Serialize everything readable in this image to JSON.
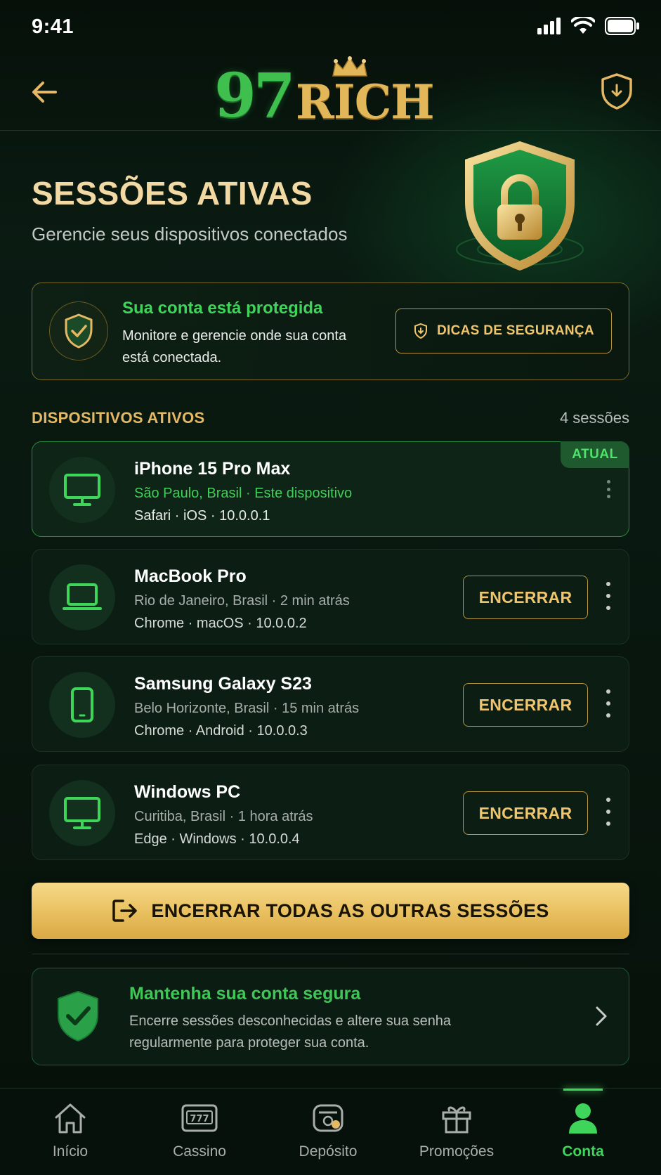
{
  "status_bar": {
    "time": "9:41"
  },
  "header": {
    "logo_number": "97",
    "logo_word": "RICH"
  },
  "hero": {
    "title": "SESSÕES ATIVAS",
    "subtitle": "Gerencie seus dispositivos conectados"
  },
  "protection": {
    "title": "Sua conta está protegida",
    "description": "Monitore e gerencie onde sua conta está conectada.",
    "tips_button": "DICAS DE SEGURANÇA"
  },
  "devices_section": {
    "title": "DISPOSITIVOS ATIVOS",
    "count": "4 sessões"
  },
  "devices": [
    {
      "name": "iPhone 15 Pro Max",
      "location": "São Paulo, Brasil · Este dispositivo",
      "meta": "Safari · iOS · 10.0.0.1",
      "badge": "ATUAL",
      "icon": "monitor-icon"
    },
    {
      "name": "MacBook Pro",
      "location": "Rio de Janeiro, Brasil · 2 min atrás",
      "meta": "Chrome · macOS · 10.0.0.2",
      "action": "ENCERRAR",
      "icon": "laptop-icon"
    },
    {
      "name": "Samsung Galaxy S23",
      "location": "Belo Horizonte, Brasil · 15 min atrás",
      "meta": "Chrome · Android · 10.0.0.3",
      "action": "ENCERRAR",
      "icon": "phone-icon"
    },
    {
      "name": "Windows PC",
      "location": "Curitiba, Brasil · 1 hora atrás",
      "meta": "Edge · Windows · 10.0.0.4",
      "action": "ENCERRAR",
      "icon": "monitor-icon"
    }
  ],
  "end_all_button": "ENCERRAR TODAS AS OUTRAS SESSÕES",
  "safety": {
    "title": "Mantenha sua conta segura",
    "description": "Encerre sessões desconhecidas e altere sua senha regularmente para proteger sua conta."
  },
  "nav": [
    {
      "label": "Início",
      "icon": "home-icon"
    },
    {
      "label": "Cassino",
      "icon": "slot-machine-icon"
    },
    {
      "label": "Depósito",
      "icon": "deposit-icon"
    },
    {
      "label": "Promoções",
      "icon": "gift-icon"
    },
    {
      "label": "Conta",
      "icon": "user-icon",
      "active": true
    }
  ],
  "colors": {
    "accent_green": "#3fd45a",
    "accent_gold": "#e4b865",
    "background": "#07140d"
  }
}
